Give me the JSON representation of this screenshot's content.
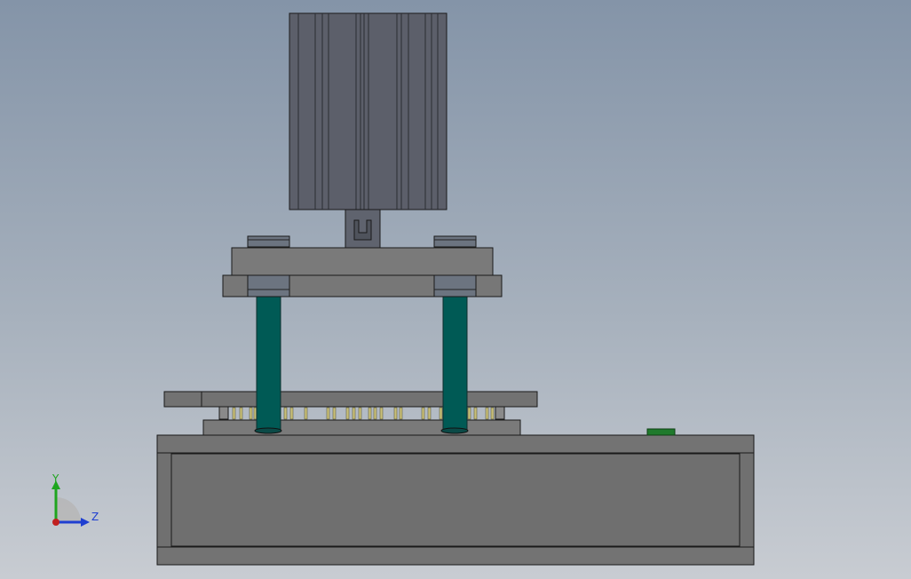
{
  "viewport": {
    "background_top": "#8494a8",
    "background_bottom": "#c8ccd2"
  },
  "colors": {
    "body_gray": "#6f6f6f",
    "plate_gray": "#7a7a7a",
    "cylinder_gray": "#5c5f6a",
    "guide_post_teal": "#005a55",
    "edge_dark": "#1a1a1a",
    "pin_yellow": "#c9c07a",
    "green_marker": "#1f7a2c"
  },
  "triad": {
    "y_label": "Y",
    "z_label": "Z",
    "y_color": "#1fa51f",
    "z_color": "#1f3fd1",
    "x_color": "#c02020"
  }
}
